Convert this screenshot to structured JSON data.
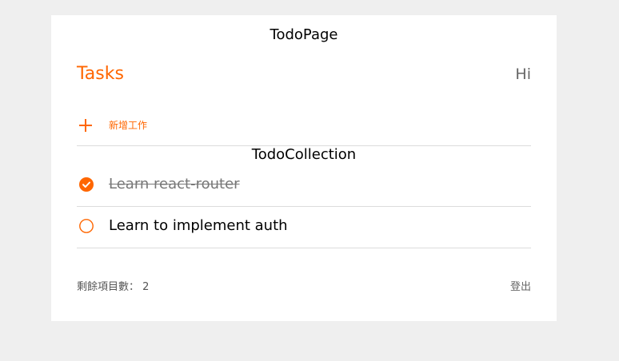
{
  "page": {
    "heading": "TodoPage"
  },
  "header": {
    "title": "Tasks",
    "greeting": "Hi"
  },
  "add_todo": {
    "label": "新增工作",
    "icon": "plus-icon"
  },
  "collection": {
    "heading": "TodoCollection",
    "items": [
      {
        "text": "Learn react-router",
        "done": true
      },
      {
        "text": "Learn to implement auth",
        "done": false
      }
    ]
  },
  "footer": {
    "remaining_label": "剩餘項目數：",
    "remaining_count": "2",
    "logout_label": "登出"
  },
  "colors": {
    "accent": "#ff6600",
    "background": "#efefef",
    "card": "#ffffff",
    "divider": "#dcdcdc"
  }
}
